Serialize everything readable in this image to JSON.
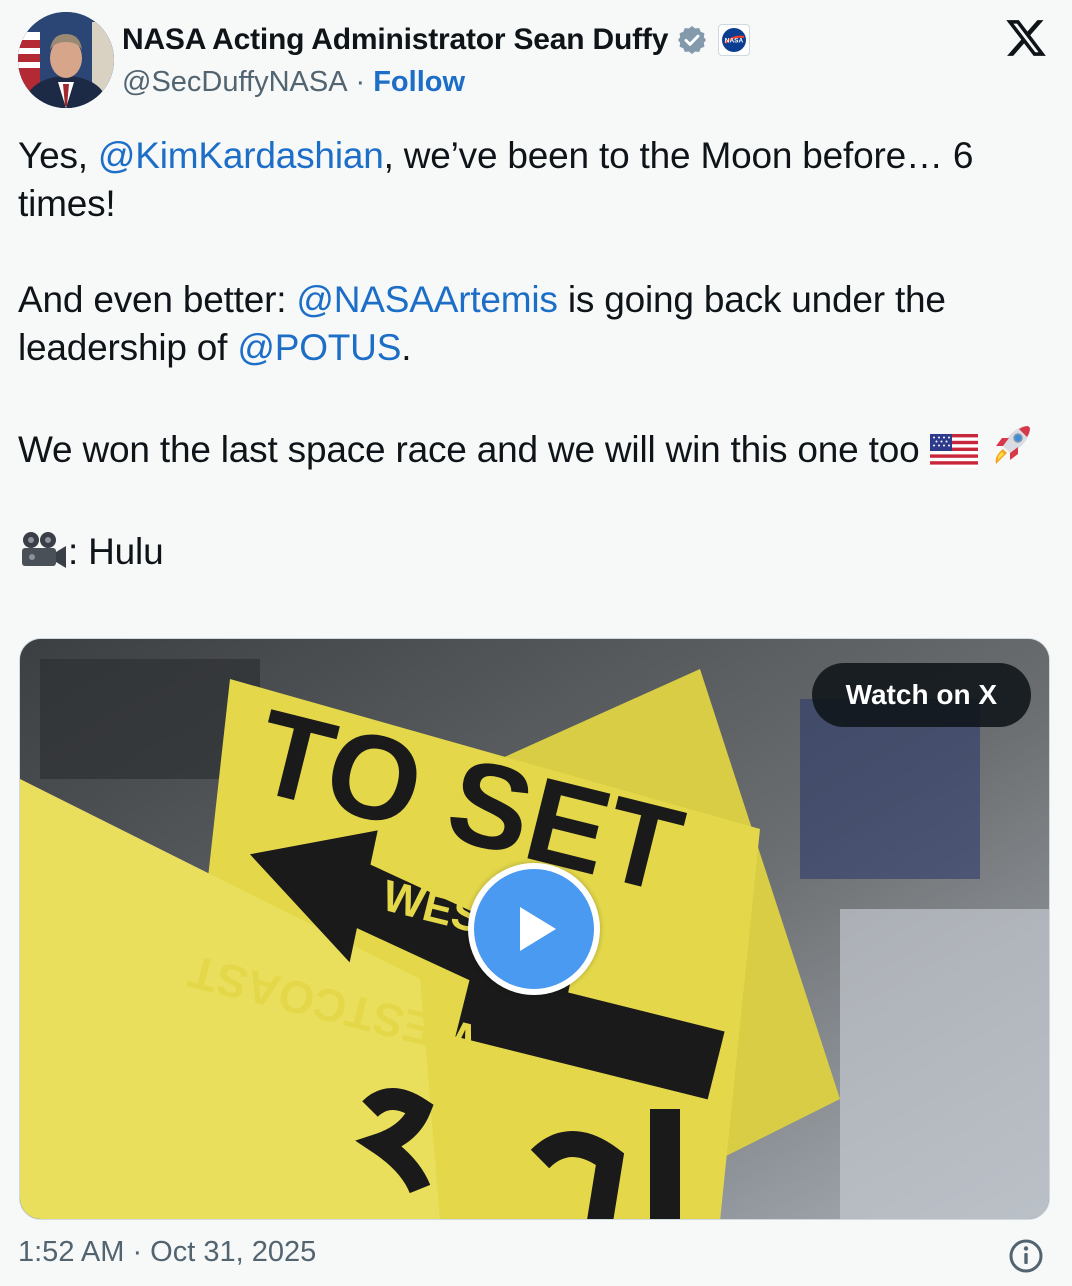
{
  "author": {
    "display_name": "NASA Acting Administrator Sean Duffy",
    "handle": "@SecDuffyNASA",
    "separator": "·",
    "follow_label": "Follow",
    "org_badge_text": "NASA"
  },
  "tweet": {
    "line1": {
      "pre": "Yes, ",
      "mention": "@KimKardashian",
      "post": ", we’ve been to the Moon before… 6 times!"
    },
    "line2": {
      "pre": "And even better: ",
      "mention1": "@NASAArtemis",
      "mid": " is going back under the leadership of ",
      "mention2": "@POTUS",
      "post": "."
    },
    "line3": {
      "text": "We won the last space race and we will win this one too"
    },
    "line4": {
      "text": ": Hulu"
    }
  },
  "media": {
    "watch_label": "Watch on X",
    "sign_words": [
      "TO SET",
      "WESTCOAST",
      "WESTCOAST"
    ]
  },
  "footer": {
    "timestamp": "1:52 AM · Oct 31, 2025"
  },
  "colors": {
    "link": "#1d6ec7",
    "secondary_text": "#536471",
    "background": "#f7f9f9",
    "play_button": "#4a9af1",
    "sign_yellow": "#e4d84a"
  }
}
